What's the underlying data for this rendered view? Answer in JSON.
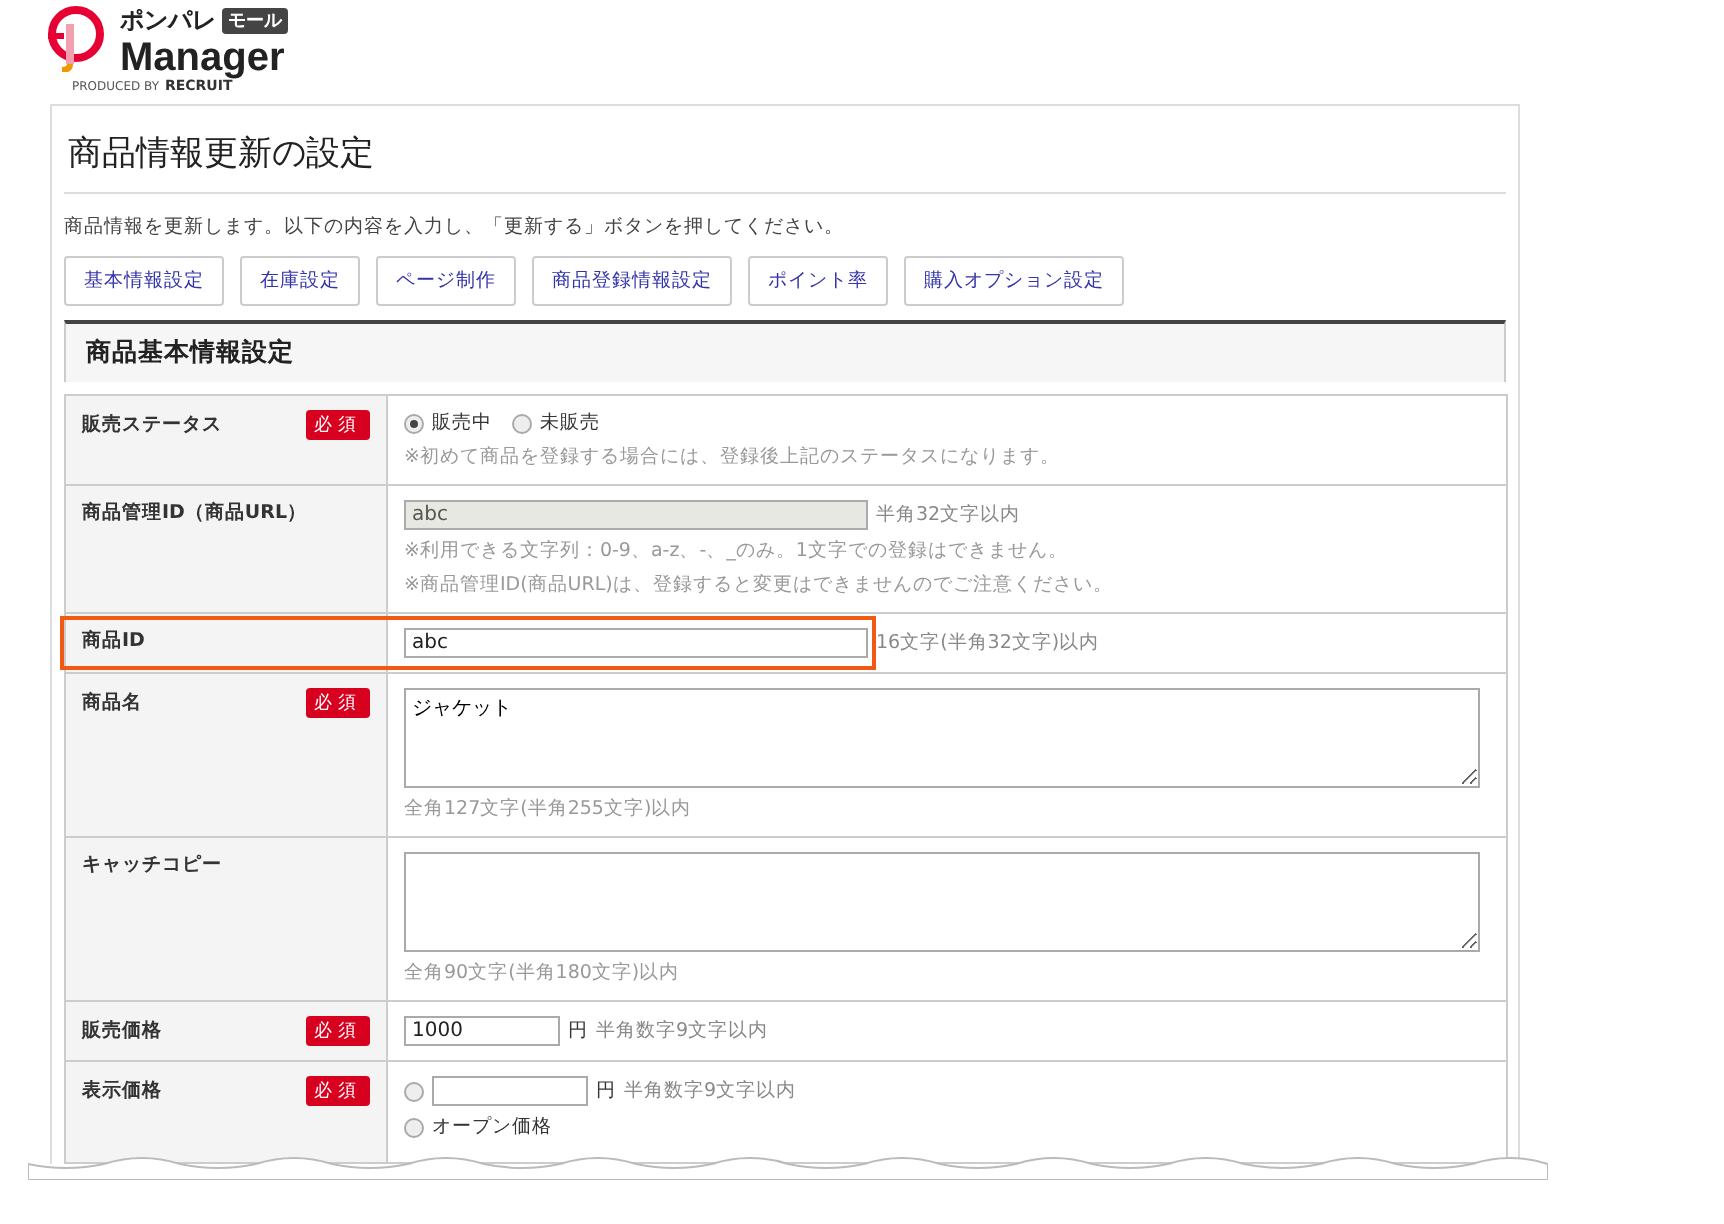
{
  "logo": {
    "brand": "ポンパレ",
    "badge": "モール",
    "product": "Manager",
    "credit": "PRODUCED BY",
    "company": "RECRUIT"
  },
  "page": {
    "title": "商品情報更新の設定",
    "description": "商品情報を更新します。以下の内容を入力し、「更新する」ボタンを押してください。"
  },
  "tabs": [
    {
      "label": "基本情報設定"
    },
    {
      "label": "在庫設定"
    },
    {
      "label": "ページ制作"
    },
    {
      "label": "商品登録情報設定"
    },
    {
      "label": "ポイント率"
    },
    {
      "label": "購入オプション設定"
    }
  ],
  "section": {
    "title": "商品基本情報設定"
  },
  "rows": [
    {
      "kind": "radio",
      "label": "販売ステータス",
      "required": true,
      "required_label": "必須",
      "options": [
        {
          "label": "販売中",
          "selected": true
        },
        {
          "label": "未販売",
          "selected": false
        }
      ],
      "notes": [
        "※初めて商品を登録する場合には、登録後上記のステータスになります。"
      ]
    },
    {
      "kind": "text",
      "label": "商品管理ID（商品URL）",
      "required": false,
      "value": "abc",
      "disabled": true,
      "hint": "半角32文字以内",
      "notes": [
        "※利用できる文字列：0-9、a-z、-、_のみ。1文字での登録はできません。",
        "※商品管理ID(商品URL)は、登録すると変更はできませんのでご注意ください。"
      ]
    },
    {
      "kind": "text",
      "label": "商品ID",
      "required": false,
      "value": "abc",
      "disabled": false,
      "highlighted": true,
      "hint": "16文字(半角32文字)以内"
    },
    {
      "kind": "textarea",
      "label": "商品名",
      "required": true,
      "required_label": "必須",
      "value": "ジャケット",
      "notes": [
        "全角127文字(半角255文字)以内"
      ]
    },
    {
      "kind": "textarea",
      "label": "キャッチコピー",
      "required": false,
      "notes": [
        "全角90文字(半角180文字)以内"
      ]
    },
    {
      "kind": "price",
      "label": "販売価格",
      "required": true,
      "required_label": "必須",
      "value": "1000",
      "unit": "円",
      "hint": "半角数字9文字以内"
    },
    {
      "kind": "price_choice",
      "label": "表示価格",
      "required": true,
      "required_label": "必須",
      "options": [
        {
          "selected": false,
          "unit": "円",
          "hint": "半角数字9文字以内"
        },
        {
          "selected": false,
          "label": "オープン価格"
        }
      ]
    }
  ]
}
